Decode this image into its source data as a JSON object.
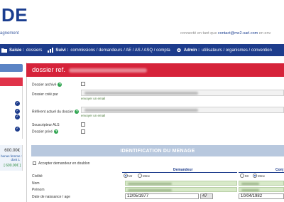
{
  "header": {
    "logo": "DE",
    "tagline": "agnement",
    "connected_prefix": "connecté en tant que ",
    "connected_email": "contact@mc2-sarl.com",
    "connected_suffix": " en env"
  },
  "navbar": {
    "items": [
      {
        "icon": "folder-icon",
        "bold": "Saisie :",
        "rest": "dossiers"
      },
      {
        "icon": "chart-icon",
        "bold": "Suivi :",
        "rest": "commissions / demandeurs / AE / AS / ASQ / compta"
      },
      {
        "icon": "gear-icon",
        "bold": "Admin :",
        "rest": "utilisateurs / organismes / convention"
      }
    ]
  },
  "sidebar": {
    "amount_main": "600.00€",
    "amount_line2": "bonus femme :",
    "amount_line3": "dont 1",
    "amount_total": "[ 600.00€ ]"
  },
  "dossier": {
    "title": "dossier ref."
  },
  "form": {
    "archived_label": "Dossier archivé",
    "created_by_label": "Dossier créé par",
    "send_email_1": "envoyer un email",
    "referent_label": "Référent actuel du dossier",
    "send_email_2": "envoyer un email",
    "als_label": "Souscripteur ALS",
    "private_label": "Dossier privé",
    "section_title": "IDENTIFICATION DU MENAGE",
    "accept_label": "Accepter demandeur en doublon",
    "col_demandeur": "Demandeur",
    "col_conjoint": "Conj",
    "civility_label": "Civilité",
    "mr_label": "Mr",
    "mme_label": "Mme",
    "nom_label": "Nom",
    "prenom_label": "Prénom",
    "birth_label": "Date de naissance / age",
    "birth_demandeur": "12/05/1977",
    "age_demandeur": "47",
    "birth_conjoint": "10/04/1982",
    "civility_demandeur_selected": "Mr",
    "civility_conjoint_selected": "Mme"
  }
}
